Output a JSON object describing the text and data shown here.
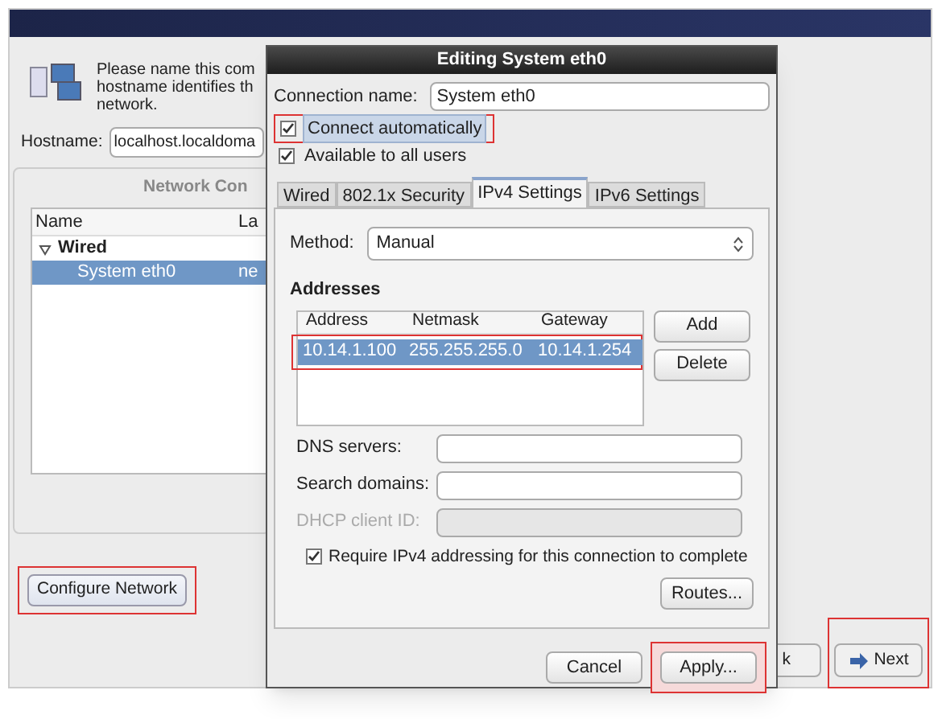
{
  "background_window": {
    "intro_lines": [
      "Please name this com",
      "hostname identifies th",
      "network."
    ],
    "hostname": {
      "label": "Hostname:",
      "value": "localhost.localdoma"
    },
    "network_connections": {
      "title": "Network Con",
      "columns": [
        "Name",
        "La"
      ],
      "rows": [
        {
          "kind": "group",
          "label": "Wired",
          "expanded": true,
          "selected": false
        },
        {
          "kind": "item",
          "label": "System eth0",
          "column_2": "ne",
          "selected": true
        }
      ]
    },
    "configure_button": "Configure Network",
    "back_button": "k",
    "next_button": "Next"
  },
  "dialog": {
    "title": "Editing System eth0",
    "connection_name": {
      "label": "Connection name:",
      "value": "System eth0"
    },
    "checkboxes": [
      {
        "label": "Connect automatically",
        "checked": true,
        "focused": true
      },
      {
        "label": "Available to all users",
        "checked": true,
        "focused": false
      }
    ],
    "tabs": [
      {
        "label": "Wired",
        "selected": false
      },
      {
        "label": "802.1x Security",
        "selected": false
      },
      {
        "label": "IPv4 Settings",
        "selected": true
      },
      {
        "label": "IPv6 Settings",
        "selected": false
      }
    ],
    "method": {
      "label": "Method:",
      "value": "Manual"
    },
    "addresses": {
      "title": "Addresses",
      "columns": [
        "Address",
        "Netmask",
        "Gateway"
      ],
      "rows": [
        {
          "cells": [
            "10.14.1.100",
            "255.255.255.0",
            "10.14.1.254"
          ],
          "selected": true
        }
      ],
      "buttons": [
        "Add",
        "Delete"
      ]
    },
    "fields": [
      {
        "label": "DNS servers:",
        "disabled": false
      },
      {
        "label": "Search domains:",
        "disabled": false
      },
      {
        "label": "DHCP client ID:",
        "disabled": true
      }
    ],
    "require_checkbox": {
      "label": "Require IPv4 addressing for this connection to complete",
      "checked": true
    },
    "routes_button": "Routes...",
    "buttons": [
      "Cancel",
      "Apply..."
    ]
  }
}
